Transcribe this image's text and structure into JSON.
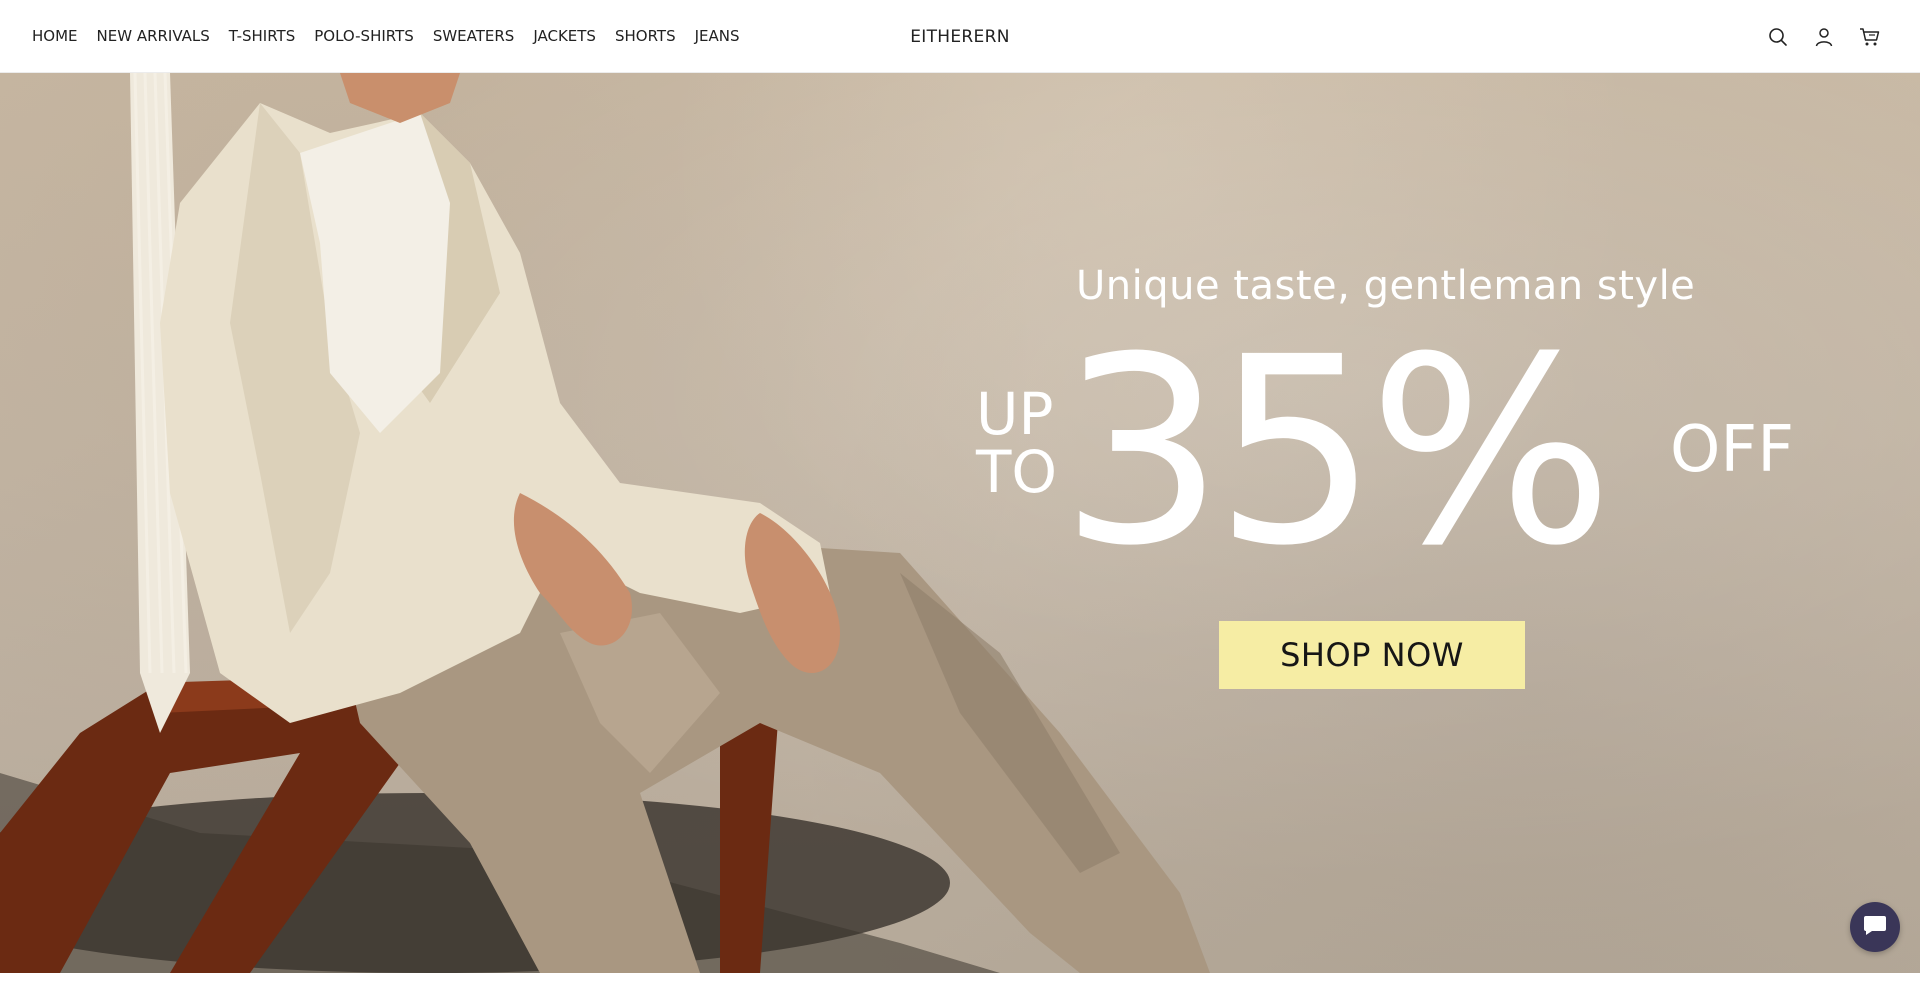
{
  "header": {
    "nav": [
      "HOME",
      "NEW ARRIVALS",
      "T-SHIRTS",
      "POLO-SHIRTS",
      "SWEATERS",
      "JACKETS",
      "SHORTS",
      "JEANS"
    ],
    "logo": "EITHERERN",
    "icons": [
      "search-icon",
      "account-icon",
      "cart-icon"
    ]
  },
  "hero": {
    "subtitle": "Unique taste, gentleman style",
    "up": "UP",
    "to": "TO",
    "amount": "35%",
    "off": "OFF",
    "cta": "SHOP NOW",
    "cta_color": "#f6eda4"
  },
  "chat": {
    "icon": "chat-bubble-icon",
    "color": "#3a3658"
  }
}
